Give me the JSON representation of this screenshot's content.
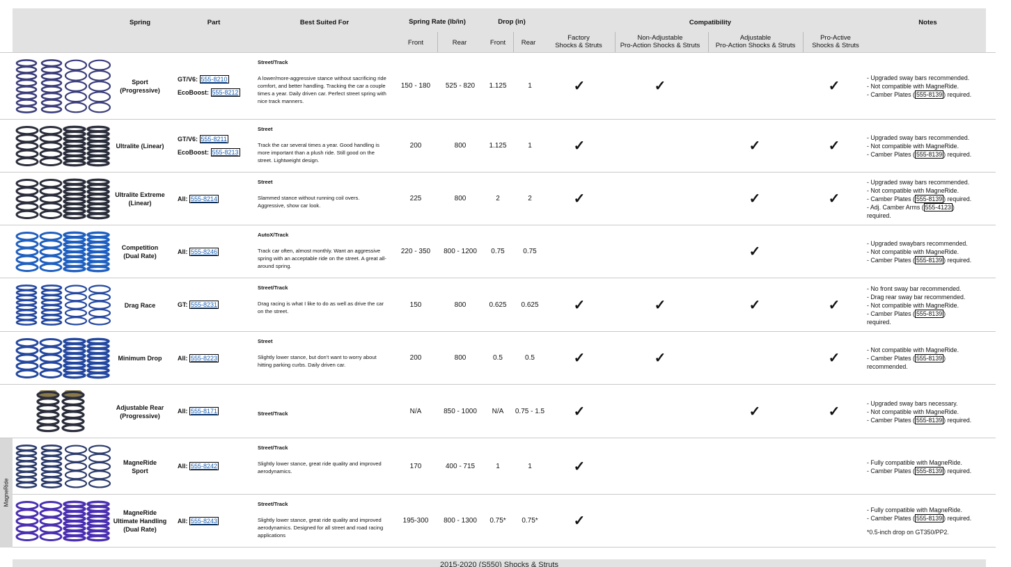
{
  "colors": {
    "header_bg": "#e2e2e2",
    "link": "#1a5fb4",
    "rule": "#c9c9c9"
  },
  "header": {
    "spring": "Spring",
    "part": "Part",
    "best_suited": "Best Suited For",
    "spring_rate": "Spring Rate (lb/in)",
    "drop": "Drop (in)",
    "compatibility": "Compatibility",
    "notes": "Notes",
    "front": "Front",
    "rear": "Rear",
    "factory": "Factory\nShocks & Struts",
    "non_adjustable": "Non-Adjustable\nPro-Action Shocks & Struts",
    "adjustable": "Adjustable\nPro-Action Shocks & Struts",
    "pro_active": "Pro-Active\nShocks & Struts"
  },
  "check_glyph": "✓",
  "side_label": "MagneRide",
  "footer_text": "2015-2020 (S550) Shocks & Struts",
  "rows": [
    {
      "name": "Sport\n(Progressive)",
      "parts": [
        {
          "label": "GT/V6:",
          "code": "555-8210"
        },
        {
          "label": "EcoBoost:",
          "code": "555-8212"
        }
      ],
      "best_title": "Street/Track",
      "best_text": "A lower/more-aggressive stance without sacrificing ride comfort, and better handling. Tracking the car a couple times a year. Daily driven car. Perfect street spring with nice track manners.",
      "rate_front": "150 - 180",
      "rate_rear": "525 - 820",
      "drop_front": "1.125",
      "drop_rear": "1",
      "compat": [
        true,
        true,
        false,
        true
      ],
      "notes": [
        "- Upgraded sway bars recommended.",
        "- Not compatible with MagneRide.",
        "- Camber Plates (|555-8139|) required."
      ],
      "spring_color": "#3a3d7a",
      "spring_style": "mixed"
    },
    {
      "name": "Ultralite (Linear)",
      "parts": [
        {
          "label": "GT/V6:",
          "code": "555-8211"
        },
        {
          "label": "EcoBoost:",
          "code": "555-8213"
        }
      ],
      "best_title": "Street",
      "best_text": "Track the car several times a year. Good handling is more important than a plush ride. Still good on the street. Lightweight design.",
      "rate_front": "200",
      "rate_rear": "800",
      "drop_front": "1.125",
      "drop_rear": "1",
      "compat": [
        true,
        false,
        true,
        true
      ],
      "notes": [
        "- Upgraded sway bars recommended.",
        "- Not compatible with MagneRide.",
        "- Camber Plates (|555-8139|) required."
      ],
      "spring_color": "#2a2d3a",
      "spring_style": "dense"
    },
    {
      "name": "Ultralite Extreme\n(Linear)",
      "parts": [
        {
          "label": "All:",
          "code": "555-8214"
        }
      ],
      "best_title": "Street",
      "best_text": "Slammed stance without running coil overs. Aggressive, show car look.",
      "rate_front": "225",
      "rate_rear": "800",
      "drop_front": "2",
      "drop_rear": "2",
      "compat": [
        true,
        false,
        true,
        true
      ],
      "notes": [
        "- Upgraded sway bars recommended.",
        "- Not compatible with MagneRide.",
        "- Camber Plates (|555-8139|) required.",
        "- Adj. Camber Arms (|555-4123|)",
        "required."
      ],
      "spring_color": "#2a2d3a",
      "spring_style": "dense"
    },
    {
      "name": "Competition\n(Dual Rate)",
      "parts": [
        {
          "label": "All:",
          "code": "555-8246"
        }
      ],
      "best_title": "AutoX/Track",
      "best_text": "Track car often, almost monthly. Want an aggressive spring with an acceptable ride on the street. A great all-around spring.",
      "rate_front": "220 - 350",
      "rate_rear": "800 - 1200",
      "drop_front": "0.75",
      "drop_rear": "0.75",
      "compat": [
        false,
        false,
        true,
        false
      ],
      "notes": [
        "- Upgraded swaybars recommended.",
        "- Not compatible with MagneRide.",
        "- Camber Plates (|555-8139|) required."
      ],
      "spring_color": "#1f5fbf",
      "spring_style": "dense"
    },
    {
      "name": "Drag Race",
      "parts": [
        {
          "label": "GT:",
          "code": "555-8231"
        }
      ],
      "best_title": "Street/Track",
      "best_text": "Drag racing is what I like to do as well as drive the car on the street.",
      "rate_front": "150",
      "rate_rear": "800",
      "drop_front": "0.625",
      "drop_rear": "0.625",
      "compat": [
        true,
        true,
        true,
        true
      ],
      "notes": [
        "- No front sway bar recommended.",
        "- Drag rear sway bar recommended.",
        "- Not compatible with MagneRide.",
        "- Camber Plates (|555-8139|)",
        "required."
      ],
      "spring_color": "#2448a0",
      "spring_style": "mixed"
    },
    {
      "name": "Minimum Drop",
      "parts": [
        {
          "label": "All:",
          "code": "555-8223"
        }
      ],
      "best_title": "Street",
      "best_text": "Slightly lower stance, but don't want to worry about hitting parking curbs. Daily driven car.",
      "rate_front": "200",
      "rate_rear": "800",
      "drop_front": "0.5",
      "drop_rear": "0.5",
      "compat": [
        true,
        true,
        false,
        true
      ],
      "notes": [
        "- Not compatible with MagneRide.",
        "- Camber Plates (|555-8139|)",
        "recommended."
      ],
      "spring_color": "#2448a0",
      "spring_style": "dense"
    },
    {
      "name": "Adjustable Rear\n(Progressive)",
      "parts": [
        {
          "label": "All:",
          "code": "555-8171"
        }
      ],
      "best_title": "Street/Track",
      "best_text": "",
      "rate_front": "N/A",
      "rate_rear": "850 - 1000",
      "drop_front": "N/A",
      "drop_rear": "0.75 - 1.5",
      "compat": [
        true,
        false,
        true,
        true
      ],
      "notes": [
        "- Upgraded sway bars necessary.",
        "- Not compatible with MagneRide.",
        "- Camber Plates (|555-8139|) required."
      ],
      "spring_color": "#2a2d3a",
      "spring_style": "adjustable"
    },
    {
      "name": "MagneRide\nSport",
      "parts": [
        {
          "label": "All:",
          "code": "555-8242"
        }
      ],
      "best_title": "Street/Track",
      "best_text": "Slightly lower stance, great ride quality and improved aerodynamics.",
      "rate_front": "170",
      "rate_rear": "400 - 715",
      "drop_front": "1",
      "drop_rear": "1",
      "compat": [
        true,
        false,
        false,
        false
      ],
      "notes": [
        "- Fully compatible with MagneRide.",
        "- Camber Plates (|555-8139|) required."
      ],
      "spring_color": "#2a3a6a",
      "spring_style": "mixed"
    },
    {
      "name": "MagneRide\nUltimate Handling\n(Dual Rate)",
      "parts": [
        {
          "label": "All:",
          "code": "555-8243"
        }
      ],
      "best_title": "Street/Track",
      "best_text": "Slightly lower stance, great ride quality and improved aerodynamics. Designed for all street and road racing applications",
      "rate_front": "195-300",
      "rate_rear": "800 - 1300",
      "drop_front": "0.75*",
      "drop_rear": "0.75*",
      "compat": [
        true,
        false,
        false,
        false
      ],
      "notes": [
        "- Fully compatible with MagneRide.",
        "- Camber Plates (|555-8139|) required.",
        "",
        "*0.5-inch drop on GT350/PP2."
      ],
      "spring_color": "#4a2fb0",
      "spring_style": "dense"
    }
  ]
}
